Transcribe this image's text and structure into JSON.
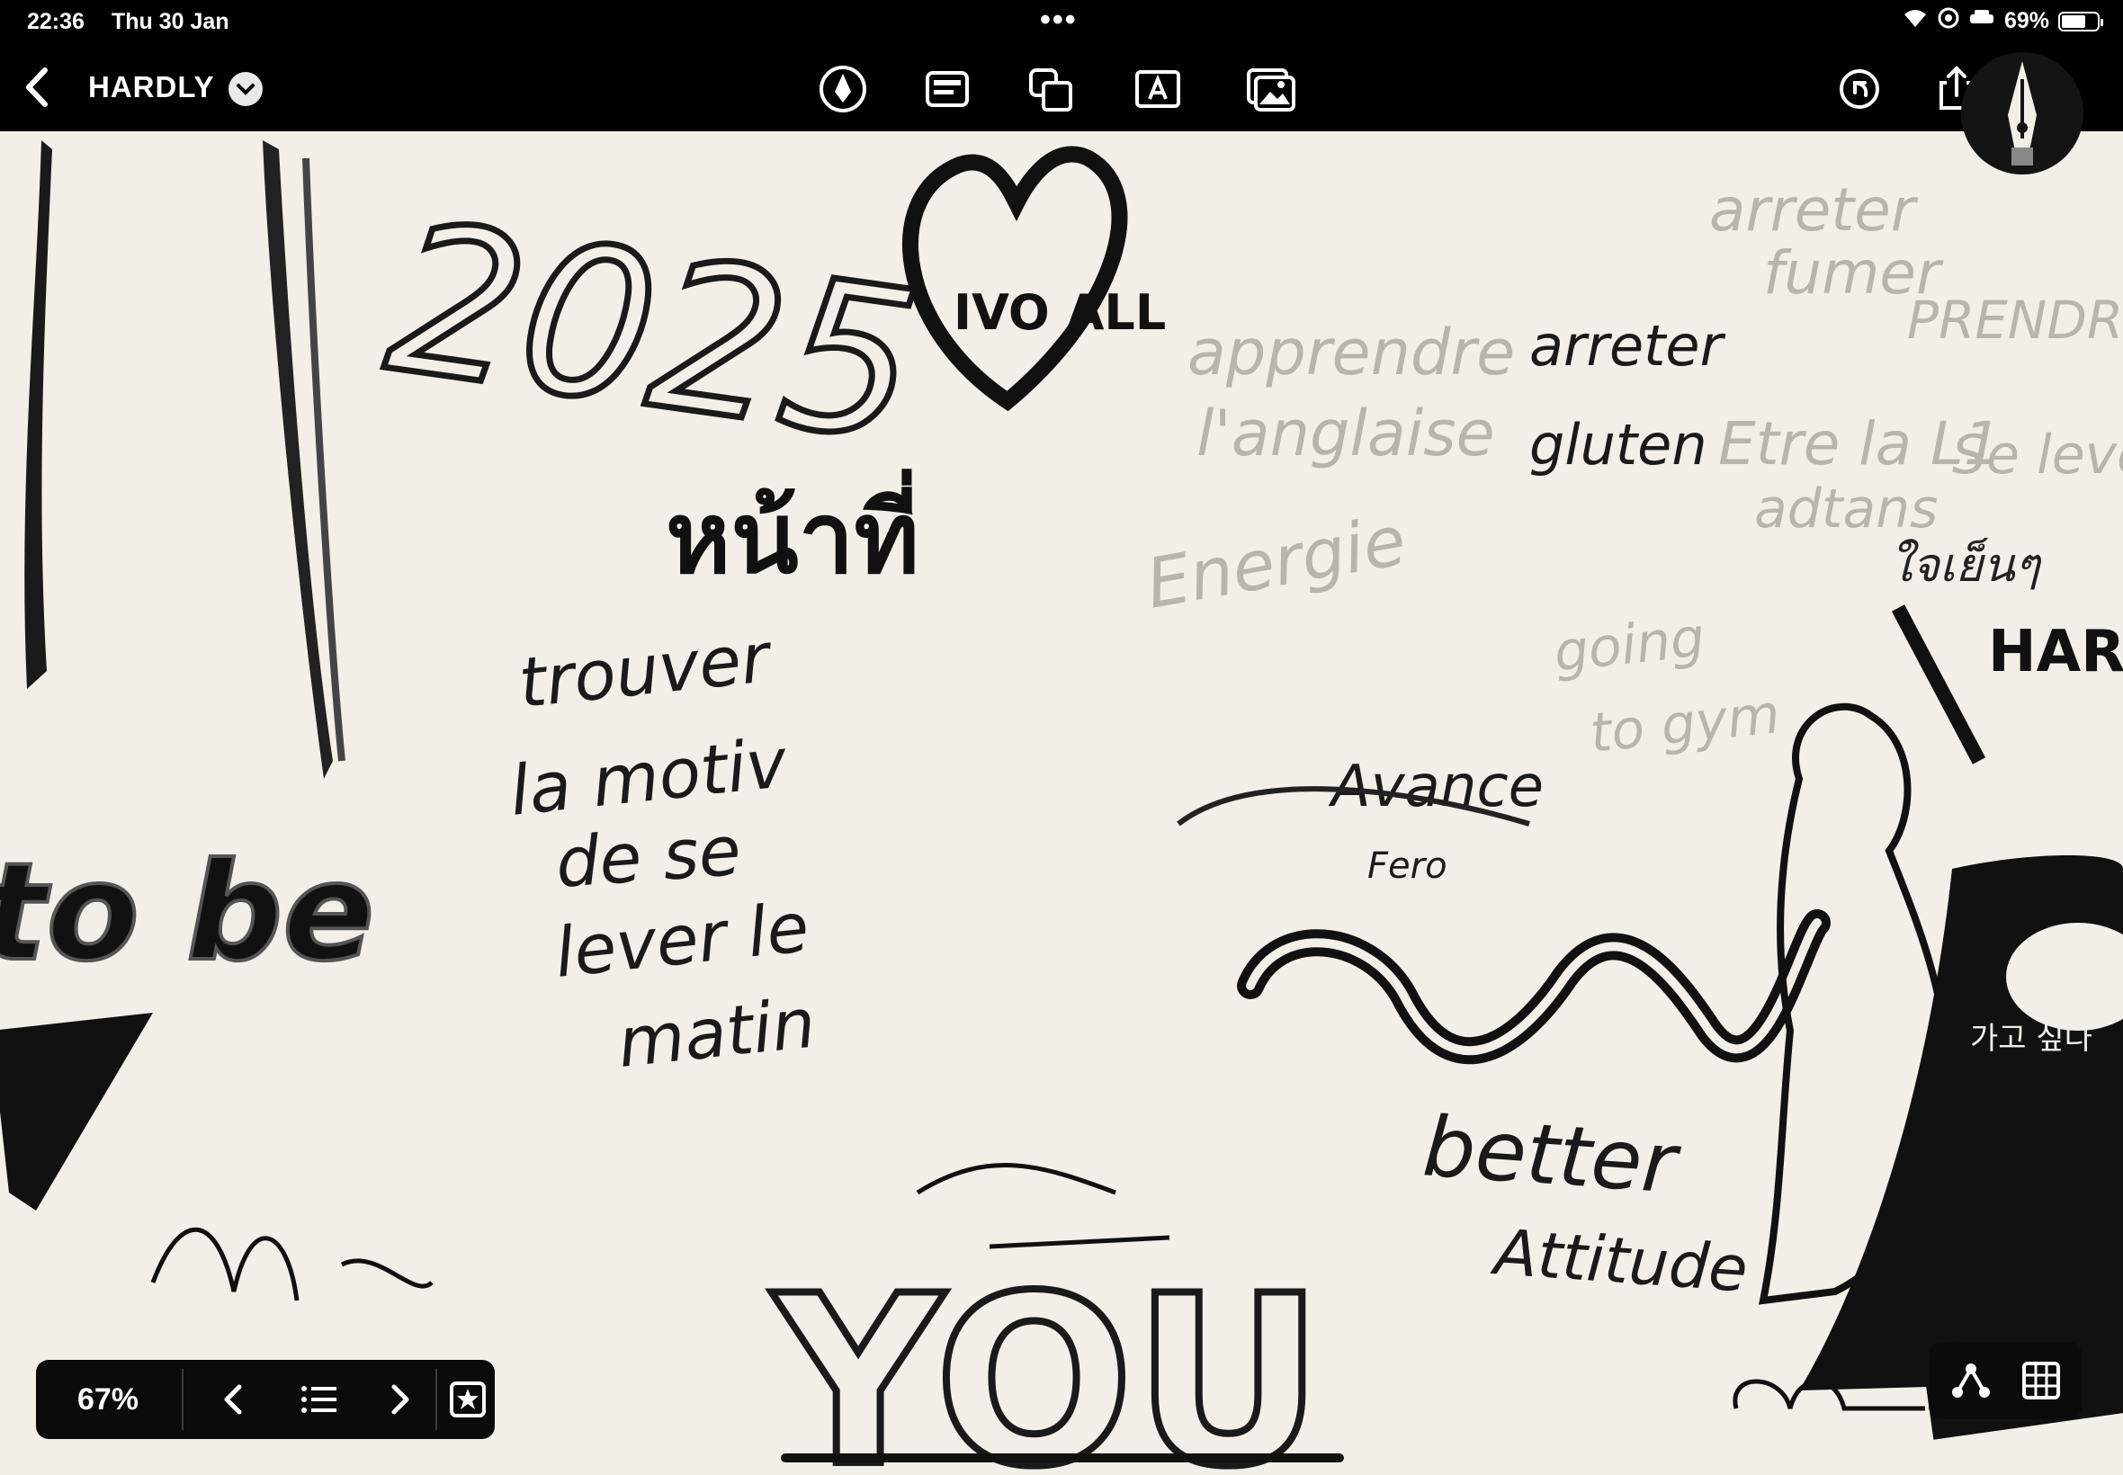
{
  "status": {
    "time": "22:36",
    "date": "Thu 30 Jan",
    "battery": "69%",
    "battery_level": 0.69
  },
  "toolbar": {
    "title": "HARDLY"
  },
  "canvas": {
    "year": "2025",
    "heart_text": "IVO ALL",
    "thai_main": "หน้าที่",
    "motivation": [
      "trouver",
      "la motiv",
      "de se",
      "lever le",
      "matin"
    ],
    "apprendre": [
      "apprendre",
      "l'anglaise"
    ],
    "energie": "Energie",
    "arreter": [
      "arreter",
      "gluten"
    ],
    "etre": [
      "Etre la L1",
      "adtans"
    ],
    "thai_small": "ใจเย็นๆ",
    "prendre": "PRENDR",
    "se_lever": "Se lever",
    "arreter_fumer": [
      "arreter",
      "fumer"
    ],
    "gym": [
      "going",
      "to gym"
    ],
    "avance": "Avance",
    "fero": "Fero",
    "better": [
      "better",
      "Attitude"
    ],
    "bottom_you": "YOU",
    "hardly": "HARD",
    "to_be": "to be",
    "korean": "가고 싶다"
  },
  "zoom": {
    "level": "67%"
  }
}
